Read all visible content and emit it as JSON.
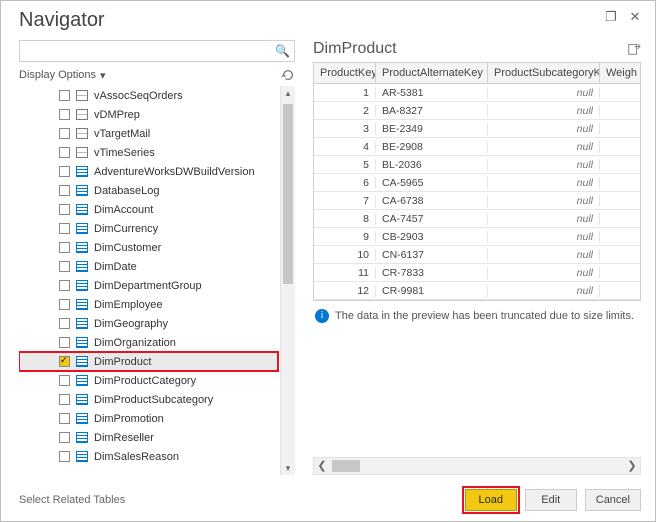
{
  "window_title": "Navigator",
  "left": {
    "display_options_label": "Display Options",
    "search_placeholder": ""
  },
  "tree_items": [
    {
      "label": "vAssocSeqOrders",
      "icon": "view",
      "checked": false
    },
    {
      "label": "vDMPrep",
      "icon": "view",
      "checked": false
    },
    {
      "label": "vTargetMail",
      "icon": "view",
      "checked": false
    },
    {
      "label": "vTimeSeries",
      "icon": "view",
      "checked": false
    },
    {
      "label": "AdventureWorksDWBuildVersion",
      "icon": "table",
      "checked": false
    },
    {
      "label": "DatabaseLog",
      "icon": "table",
      "checked": false
    },
    {
      "label": "DimAccount",
      "icon": "table",
      "checked": false
    },
    {
      "label": "DimCurrency",
      "icon": "table",
      "checked": false
    },
    {
      "label": "DimCustomer",
      "icon": "table",
      "checked": false
    },
    {
      "label": "DimDate",
      "icon": "table",
      "checked": false
    },
    {
      "label": "DimDepartmentGroup",
      "icon": "table",
      "checked": false
    },
    {
      "label": "DimEmployee",
      "icon": "table",
      "checked": false
    },
    {
      "label": "DimGeography",
      "icon": "table",
      "checked": false
    },
    {
      "label": "DimOrganization",
      "icon": "table",
      "checked": false
    },
    {
      "label": "DimProduct",
      "icon": "table",
      "checked": true,
      "selected": true,
      "highlight": true
    },
    {
      "label": "DimProductCategory",
      "icon": "table",
      "checked": false
    },
    {
      "label": "DimProductSubcategory",
      "icon": "table",
      "checked": false
    },
    {
      "label": "DimPromotion",
      "icon": "table",
      "checked": false
    },
    {
      "label": "DimReseller",
      "icon": "table",
      "checked": false
    },
    {
      "label": "DimSalesReason",
      "icon": "table",
      "checked": false
    }
  ],
  "right": {
    "title": "DimProduct",
    "columns": [
      "ProductKey",
      "ProductAlternateKey",
      "ProductSubcategoryKey",
      "Weigh"
    ],
    "info_text": "The data in the preview has been truncated due to size limits."
  },
  "grid_rows": [
    {
      "k": "1",
      "alt": "AR-5381",
      "sub": "null",
      "w": ""
    },
    {
      "k": "2",
      "alt": "BA-8327",
      "sub": "null",
      "w": ""
    },
    {
      "k": "3",
      "alt": "BE-2349",
      "sub": "null",
      "w": ""
    },
    {
      "k": "4",
      "alt": "BE-2908",
      "sub": "null",
      "w": ""
    },
    {
      "k": "5",
      "alt": "BL-2036",
      "sub": "null",
      "w": ""
    },
    {
      "k": "6",
      "alt": "CA-5965",
      "sub": "null",
      "w": ""
    },
    {
      "k": "7",
      "alt": "CA-6738",
      "sub": "null",
      "w": ""
    },
    {
      "k": "8",
      "alt": "CA-7457",
      "sub": "null",
      "w": ""
    },
    {
      "k": "9",
      "alt": "CB-2903",
      "sub": "null",
      "w": ""
    },
    {
      "k": "10",
      "alt": "CN-6137",
      "sub": "null",
      "w": ""
    },
    {
      "k": "11",
      "alt": "CR-7833",
      "sub": "null",
      "w": ""
    },
    {
      "k": "12",
      "alt": "CR-9981",
      "sub": "null",
      "w": ""
    }
  ],
  "footer": {
    "select_related": "Select Related Tables",
    "load": "Load",
    "edit": "Edit",
    "cancel": "Cancel"
  }
}
